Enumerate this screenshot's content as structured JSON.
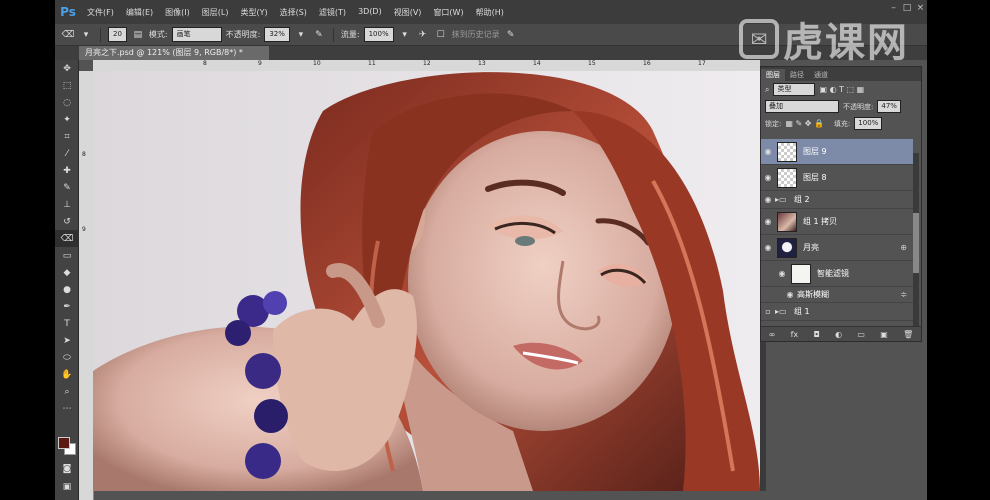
{
  "app": {
    "logo": "Ps",
    "accent": "#4a9fe8"
  },
  "menu": [
    "文件(F)",
    "编辑(E)",
    "图像(I)",
    "图层(L)",
    "类型(Y)",
    "选择(S)",
    "滤镜(T)",
    "3D(D)",
    "视图(V)",
    "窗口(W)",
    "帮助(H)"
  ],
  "options": {
    "brush_size": "20",
    "mode_label": "模式:",
    "mode_value": "画笔",
    "opacity_label": "不透明度:",
    "opacity_value": "32%",
    "flow_label": "流量:",
    "flow_value": "100%",
    "history_label": "抹到历史记录"
  },
  "document": {
    "tab_title": "月亮之下.psd @ 121% (图层 9, RGB/8*) *"
  },
  "rulers": {
    "top": [
      "8",
      "9",
      "10",
      "11",
      "12",
      "13",
      "14",
      "15",
      "16",
      "17"
    ],
    "left": [
      "8",
      "9"
    ]
  },
  "layers_panel": {
    "tabs": [
      "图层",
      "路径",
      "通道"
    ],
    "kind_filter": "类型",
    "blend_mode": "叠加",
    "opacity_label": "不透明度:",
    "opacity_value": "47%",
    "lock_label": "锁定:",
    "fill_label": "填充:",
    "fill_value": "100%",
    "layers": [
      {
        "name": "图层 9",
        "thumb": "trans",
        "selected": true
      },
      {
        "name": "图层 8",
        "thumb": "trans",
        "selected": false
      },
      {
        "name": "组 2",
        "thumb": "folder",
        "selected": false
      },
      {
        "name": "组 1 拷贝",
        "thumb": "photo",
        "selected": false
      },
      {
        "name": "月亮",
        "thumb": "moon",
        "selected": false
      },
      {
        "name": "智能滤镜",
        "thumb": "white",
        "selected": false
      },
      {
        "name": "高斯模糊",
        "thumb": "none",
        "selected": false
      },
      {
        "name": "组 1",
        "thumb": "folder",
        "selected": false
      }
    ]
  },
  "colors": {
    "foreground": "#5b1a14",
    "background": "#ffffff",
    "selected_layer": "#7d8aa8"
  },
  "watermark": "虎课网"
}
